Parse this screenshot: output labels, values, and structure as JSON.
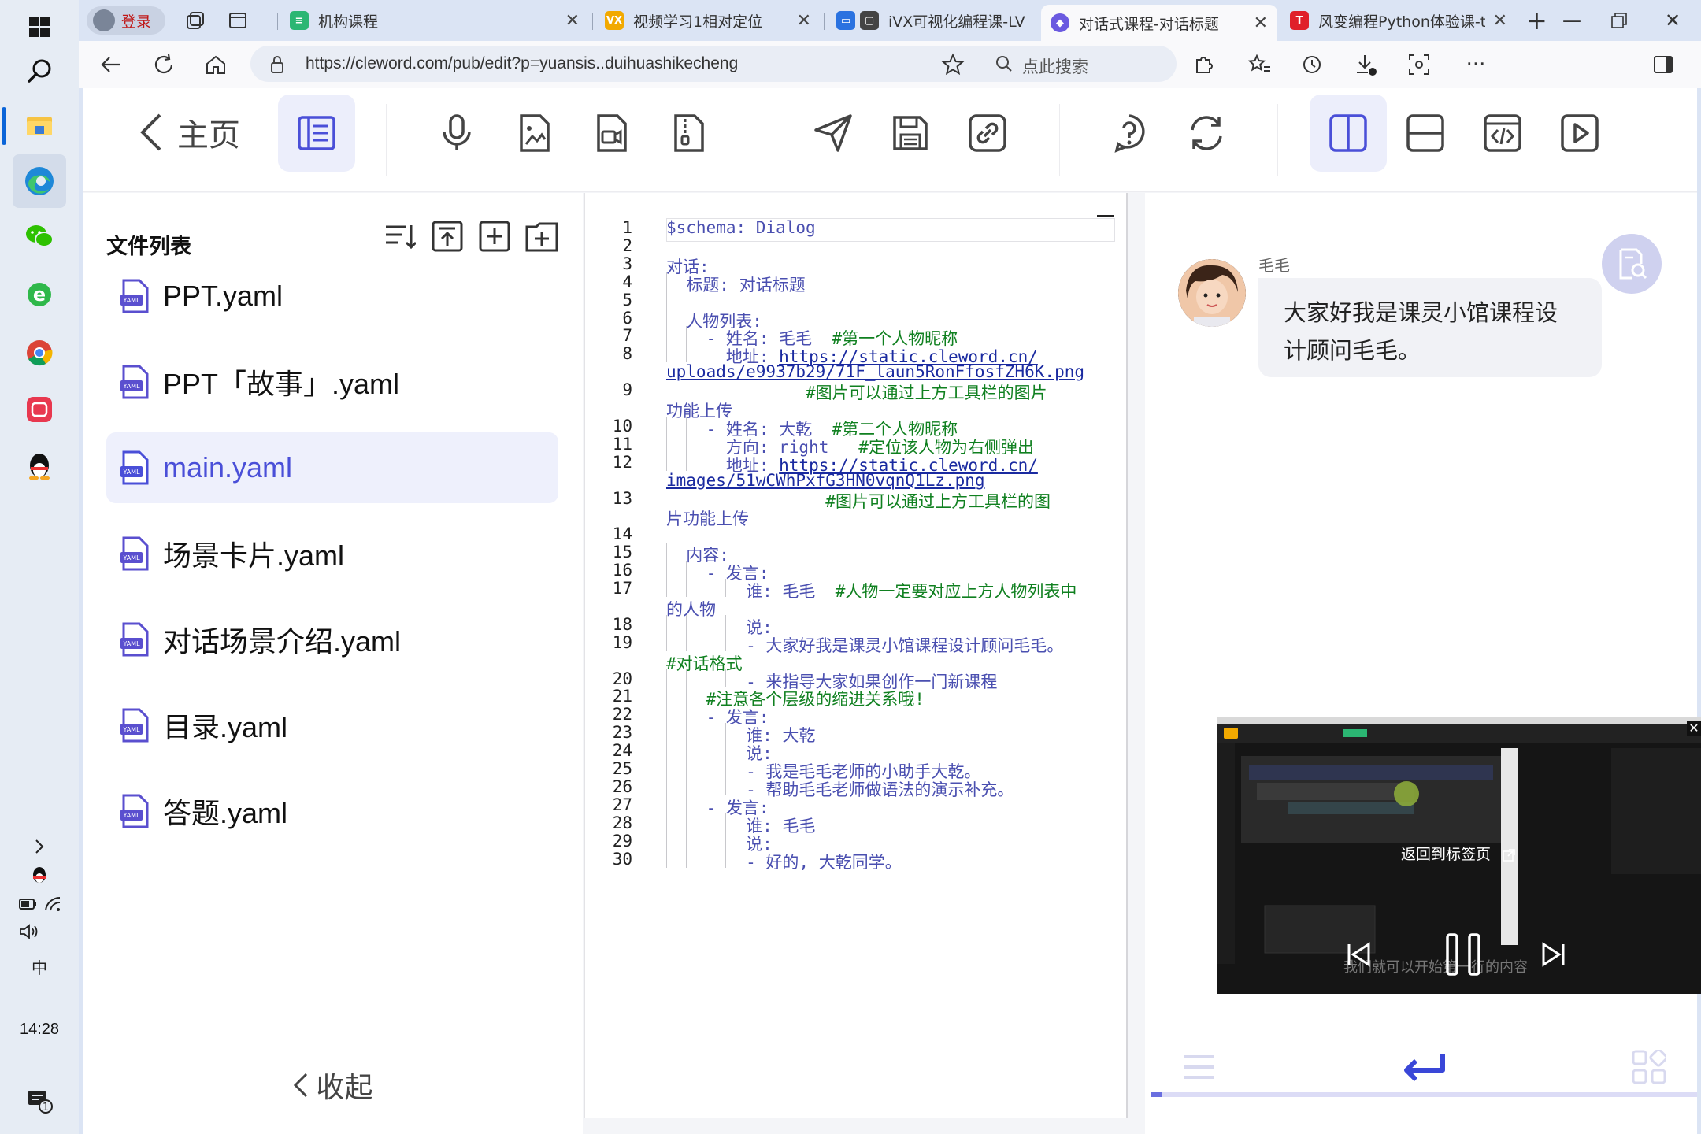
{
  "taskbar": {
    "time": "14:28",
    "notification_count": "1",
    "ime": "中"
  },
  "browser": {
    "tabs": [
      {
        "title": "登录",
        "kind": "profile"
      },
      {
        "title": "机构课程",
        "active": false
      },
      {
        "title": "视频学习1相对定位",
        "active": false
      },
      {
        "title": "iVX可视化编程课-LV",
        "active": false
      },
      {
        "title": "对话式课程-对话标题",
        "active": true
      },
      {
        "title": "风变编程Python体验课-t",
        "active": false
      }
    ],
    "url": "https://cleword.com/pub/edit?p=yuansis..duihuashikecheng",
    "search_placeholder": "点此搜索"
  },
  "app": {
    "home_label": "主页",
    "filelist": {
      "title": "文件列表",
      "files": [
        "PPT.yaml",
        "PPT「故事」.yaml",
        "main.yaml",
        "场景卡片.yaml",
        "对话场景介绍.yaml",
        "目录.yaml",
        "答题.yaml"
      ],
      "active_index": 2,
      "collapse_label": "收起",
      "file_badge": "YAML"
    },
    "editor": {
      "lines": [
        {
          "n": "1",
          "indent": 0,
          "text": "$schema: Dialog"
        },
        {
          "n": "2",
          "indent": 0,
          "text": ""
        },
        {
          "n": "3",
          "indent": 0,
          "text": "对话:"
        },
        {
          "n": "4",
          "indent": 1,
          "text": "标题: 对话标题"
        },
        {
          "n": "5",
          "indent": 1,
          "text": ""
        },
        {
          "n": "6",
          "indent": 1,
          "text": "人物列表:"
        },
        {
          "n": "7",
          "indent": 2,
          "text": "- 姓名: 毛毛  #第一个人物昵称"
        },
        {
          "n": "8",
          "indent": 3,
          "text": "地址: https://static.cleword.cn/"
        },
        {
          "n": "",
          "indent": 0,
          "text": "uploads/e9937b29/71F_laun5RonFfosfZH6K.png"
        },
        {
          "n": "9",
          "indent": 0,
          "text": "              #图片可以通过上方工具栏的图片"
        },
        {
          "n": "",
          "indent": 0,
          "text": "功能上传"
        },
        {
          "n": "10",
          "indent": 2,
          "text": "- 姓名: 大乾  #第二个人物昵称"
        },
        {
          "n": "11",
          "indent": 3,
          "text": "方向: right   #定位该人物为右侧弹出"
        },
        {
          "n": "12",
          "indent": 3,
          "text": "地址: https://static.cleword.cn/"
        },
        {
          "n": "",
          "indent": 0,
          "text": "images/51wCWhPxfG3HN0vqnQ1Lz.png"
        },
        {
          "n": "13",
          "indent": 0,
          "text": "                #图片可以通过上方工具栏的图"
        },
        {
          "n": "",
          "indent": 0,
          "text": "片功能上传"
        },
        {
          "n": "14",
          "indent": 0,
          "text": ""
        },
        {
          "n": "15",
          "indent": 1,
          "text": "内容:"
        },
        {
          "n": "16",
          "indent": 2,
          "text": "- 发言:"
        },
        {
          "n": "17",
          "indent": 4,
          "text": "谁: 毛毛  #人物一定要对应上方人物列表中"
        },
        {
          "n": "",
          "indent": 0,
          "text": "的人物"
        },
        {
          "n": "18",
          "indent": 4,
          "text": "说:"
        },
        {
          "n": "19",
          "indent": 4,
          "text": "- 大家好我是课灵小馆课程设计顾问毛毛。"
        },
        {
          "n": "",
          "indent": 0,
          "text": "#对话格式"
        },
        {
          "n": "20",
          "indent": 4,
          "text": "- 来指导大家如果创作一门新课程"
        },
        {
          "n": "21",
          "indent": 2,
          "text": "#注意各个层级的缩进关系哦!"
        },
        {
          "n": "22",
          "indent": 2,
          "text": "- 发言:"
        },
        {
          "n": "23",
          "indent": 4,
          "text": "谁: 大乾"
        },
        {
          "n": "24",
          "indent": 4,
          "text": "说:"
        },
        {
          "n": "25",
          "indent": 4,
          "text": "- 我是毛毛老师的小助手大乾。"
        },
        {
          "n": "26",
          "indent": 4,
          "text": "- 帮助毛毛老师做语法的演示补充。"
        },
        {
          "n": "27",
          "indent": 2,
          "text": "- 发言:"
        },
        {
          "n": "28",
          "indent": 4,
          "text": "谁: 毛毛"
        },
        {
          "n": "29",
          "indent": 4,
          "text": "说:"
        },
        {
          "n": "30",
          "indent": 4,
          "text": "- 好的, 大乾同学。"
        }
      ]
    },
    "preview": {
      "speaker": "毛毛",
      "message": "大家好我是课灵小馆课程设计顾问毛毛。",
      "progress_percent": 2
    },
    "video_overlay": {
      "tip": "返回到标签页",
      "subtitle": "我们就可以开始第一行的内容"
    }
  },
  "colors": {
    "accent": "#4a4fd8",
    "selected_bg": "#eceefb",
    "comment": "#108020"
  }
}
